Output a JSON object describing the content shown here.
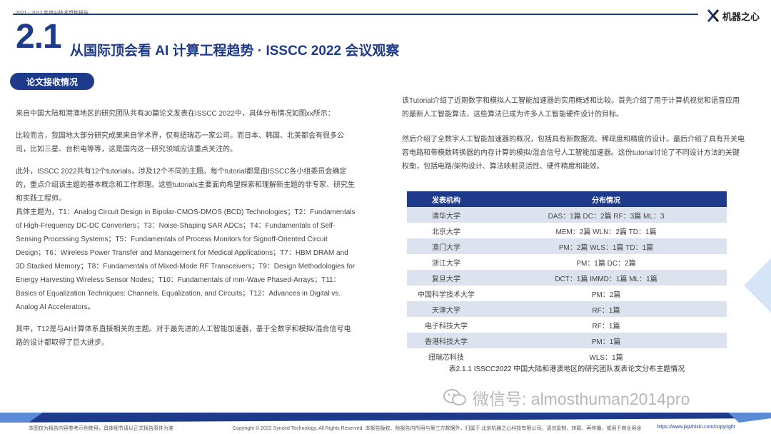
{
  "header": {
    "report_label": "2021 - 2022 年度AI技术趋势报告",
    "logo_text": "机器之心"
  },
  "section": {
    "number": "2.1",
    "title": "从国际顶会看 AI 计算工程趋势 · ISSCC 2022 会议观察",
    "pill_label": "论文接收情况"
  },
  "left_paragraphs": [
    "来自中国大陆和港澳地区的研究团队共有30篇论文发表在ISSCC 2022中，具体分布情况如图xx所示：",
    "比较而言，我国地大部分研究成果来自学术界，仅有纽瑞芯一家公司。而日本、韩国、北美都会有很多公司，比如三星、台积电等等，这是国内这一研究领域应该重点关注的。",
    "此外，ISSCC 2022共有12个tutorials，涉及12个不同的主题。每个tutorial都是由ISSCC各小组委员会确定的，重点介绍该主题的基本概念和工作原理。这些tutorials主要面向希望探索和理解新主题的非专家、研究生和实践工程师。",
    "具体主题为，T1：Analog Circuit Design in Bipolar-CMOS-DMOS (BCD) Technologies；T2：Fundamentals of High-Frequency DC-DC Converters；T3：Noise-Shaping SAR ADCs；T4：Fundamentals of Self-Sensing Processing Systems；T5：Fundamentals of Process Monitors for Signoff-Oriented Circuit Design；T6：Wireless Power Transfer and Management for Medical Applications；T7：HBM DRAM and 3D Stacked Memory；T8：Fundamentals of Mixed-Mode RF Transceivers；T9：Design Methodologies for Energy Harvesting Wireless Sensor Nodes；T10：Fundamentals of mm-Wave Phased-Arrays；T11：Basics of Equalization Techniques: Channels, Equalization, and Circuits；T12：Advances in Digital vs. Analog AI Accelerators。",
    "其中，T12是与AI计算体系直接相关的主题。对于最先进的人工智能加速器，基于全数字和模拟/混合信号电路的设计都取得了巨大进步。"
  ],
  "right_paragraphs": [
    "该Tutorial介绍了近期数字和模拟人工智能加速器的实用概述和比较。首先介绍了用于计算机视觉和语音应用的最新人工智能算法，这些算法已成为许多人工智能硬件设计的目标。",
    "然后介绍了全数字人工智能加速器的概况，包括具有新数据流、稀疏度和精度的设计。最后介绍了具有开关电容电路和带模数转换器的内存计算的模拟/混合信号人工智能加速器。这份tutorial讨论了不同设计方法的关键权衡，包括电路/架构设计、算法映射灵活性、硬件精度和能效。"
  ],
  "table": {
    "headers": [
      "发表机构",
      "分布情况"
    ],
    "rows": [
      [
        "清华大学",
        "DAS：1篇  DC：2篇  RF：3篇 ML：3"
      ],
      [
        "北京大学",
        "MEM：2篇 WLN：2篇 TD：1篇"
      ],
      [
        "澳门大学",
        "PM：2篇 WLS：1篇 TD：1篇"
      ],
      [
        "浙江大学",
        "PM：1篇 DC：2篇"
      ],
      [
        "复旦大学",
        "DCT：1篇 IMMD：1篇 ML：1篇"
      ],
      [
        "中国科学技术大学",
        "PM：2篇"
      ],
      [
        "天津大学",
        "RF：1篇"
      ],
      [
        "电子科技大学",
        "RF：1篇"
      ],
      [
        "香港科技大学",
        "PM：1篇"
      ],
      [
        "纽瑞芯科技",
        "WLS：1篇"
      ]
    ]
  },
  "caption": "表2.1.1 ISSCC2022 中国大陆和港澳地区的研究团队发表论文分布主题情况",
  "watermark_text": "微信号: almosthuman2014pro",
  "footer": {
    "left_note": "本图仅为报告内容参考示例使用，具体细节请以正式报告原件为准",
    "copyright": "Copyright © 2022 Synced Technology. All Rights Reserved. 本报告版权、除报告内所用与第三方数据外，归属于 北京机器之心科技有限公司。请勿复制、转载、再传播，或用于商业用途",
    "link": "https://www.jiqizhixin.com/copyright"
  },
  "colors": {
    "primary": "#1e3a8a",
    "row_alt": "#dde3ee",
    "watermark": "#b8b8b8"
  }
}
